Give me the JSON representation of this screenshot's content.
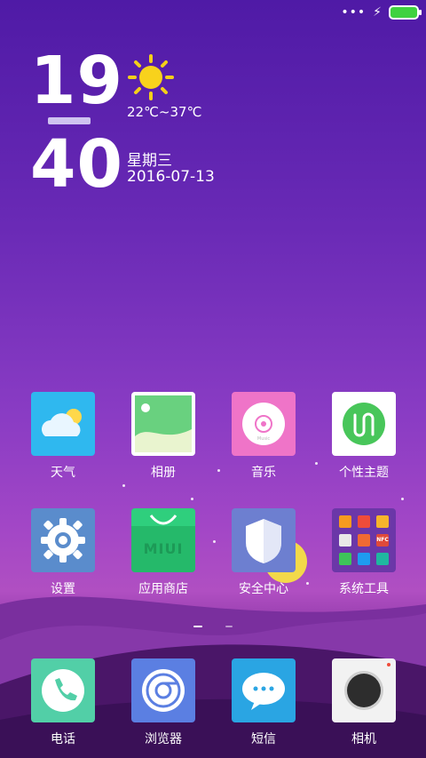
{
  "status_bar": {
    "more_icon": "ellipsis-icon",
    "charging_icon": "bolt-icon",
    "battery_color": "#3fd23f"
  },
  "clock": {
    "hour": "19",
    "minute": "40"
  },
  "weather_widget": {
    "icon": "sun-icon",
    "temperature": "22℃~37℃"
  },
  "date_widget": {
    "weekday": "星期三",
    "date": "2016-07-13"
  },
  "apps_row1": [
    {
      "label": "天气",
      "icon": "weather-icon"
    },
    {
      "label": "相册",
      "icon": "gallery-icon"
    },
    {
      "label": "音乐",
      "icon": "music-icon"
    },
    {
      "label": "个性主题",
      "icon": "theme-icon"
    }
  ],
  "apps_row2": [
    {
      "label": "设置",
      "icon": "settings-icon"
    },
    {
      "label": "应用商店",
      "icon": "app-store-icon",
      "badge_text": "MIUI"
    },
    {
      "label": "安全中心",
      "icon": "security-center-icon"
    },
    {
      "label": "系统工具",
      "icon": "system-tools-folder-icon",
      "nfc_text": "NFC"
    }
  ],
  "dock": [
    {
      "label": "电话",
      "icon": "phone-icon"
    },
    {
      "label": "浏览器",
      "icon": "browser-icon"
    },
    {
      "label": "短信",
      "icon": "sms-icon"
    },
    {
      "label": "相机",
      "icon": "camera-icon"
    }
  ],
  "music_icon_caption": "Music"
}
